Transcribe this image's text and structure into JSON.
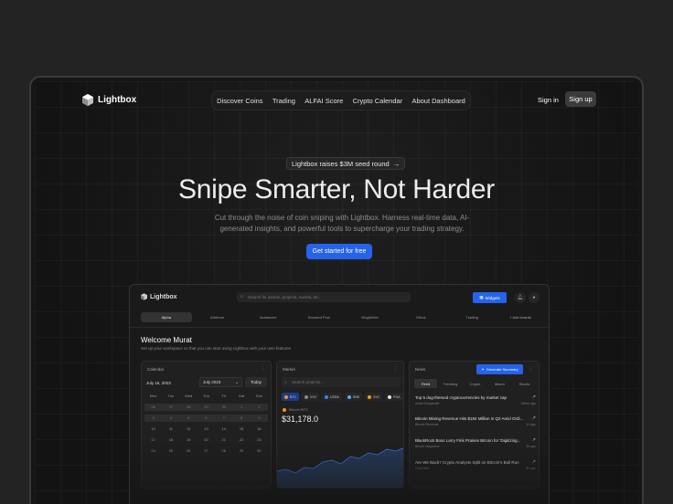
{
  "brand": {
    "name": "Lightbox",
    "icon": "cube-icon"
  },
  "nav": {
    "items": [
      "Discover Coins",
      "Trading",
      "ALFAI Score",
      "Crypto Calendar",
      "About Dashboard"
    ],
    "signin": "Sign in",
    "signup": "Sign up"
  },
  "hero": {
    "announcement": "Lightbox raises $3M seed round",
    "announcement_icon": "arrow-right-icon",
    "title": "Snipe Smarter, Not Harder",
    "subtitle": "Cut through the noise of coin sniping with Lightbox. Harness real-time data, AI-generated insights, and powerful tools to supercharge your trading strategy.",
    "cta": "Get started for free"
  },
  "dashboard": {
    "brand": "Lightbox",
    "search_placeholder": "Search for assets, projects, events, etc.",
    "widgets_label": "Widgets",
    "tabs": [
      "Alpha",
      "Arbitrum",
      "Avalanche",
      "Boosted Pool",
      "BlogWriter",
      "Ethos",
      "Trading"
    ],
    "add_boards": "+ Add boards",
    "welcome_title": "Welcome Murat",
    "welcome_sub": "Set up your workspace so that you can start using Lightbox with your own features",
    "calendar": {
      "title": "Calendar",
      "selected_date": "July 16, 2023",
      "month": "July 2023",
      "today": "Today",
      "weekdays": [
        "Mon",
        "Tue",
        "Wed",
        "Thu",
        "Fri",
        "Sat",
        "Sun"
      ],
      "days": [
        "26",
        "27",
        "28",
        "29",
        "30",
        "1",
        "2",
        "3",
        "4",
        "5",
        "6",
        "7",
        "8",
        "9",
        "10",
        "11",
        "12",
        "13",
        "14",
        "15",
        "16",
        "17",
        "18",
        "19",
        "20",
        "21",
        "22",
        "23",
        "24",
        "25",
        "26",
        "27",
        "28",
        "29",
        "30"
      ]
    },
    "market": {
      "title": "Market",
      "search_placeholder": "Search projects...",
      "chips": [
        {
          "label": "BTC",
          "color": "#f7931a"
        },
        {
          "label": "VVV",
          "color": "#888888"
        },
        {
          "label": "USDA",
          "color": "#3b82f6"
        },
        {
          "label": "SNS",
          "color": "#60a5fa"
        },
        {
          "label": "XXC",
          "color": "#f59e0b"
        },
        {
          "label": "PGA",
          "color": "#e5e5e5"
        }
      ],
      "coin": "Bitcoin BTC",
      "price": "$31,178.0"
    },
    "news": {
      "title": "News",
      "generate": "Generate Summary",
      "tabs": [
        "Feed",
        "Trending",
        "Crypto",
        "Macro",
        "Stocks"
      ],
      "items": [
        {
          "title": "Top 5 dog-themed cryptocurrencies by market cap",
          "author": "Andre Bregander",
          "time": "15min ago"
        },
        {
          "title": "Bitcoin Mining Revenue Hits $184 Million in Q2 Amid Ordi...",
          "author": "Bitcoin Revenue",
          "time": "1h ago"
        },
        {
          "title": "BlackRock Boss Larry Fink Praises Bitcoin for 'Digitizing...",
          "author": "Bitcoin Magazine",
          "time": "2h ago"
        },
        {
          "title": "Are We Back? Crypto Analysts Split on Bitcoin's Bull Run",
          "author": "CoinDesk",
          "time": "3h ago"
        }
      ]
    }
  },
  "colors": {
    "accent": "#2563eb",
    "background": "#232323",
    "surface": "#151515"
  }
}
